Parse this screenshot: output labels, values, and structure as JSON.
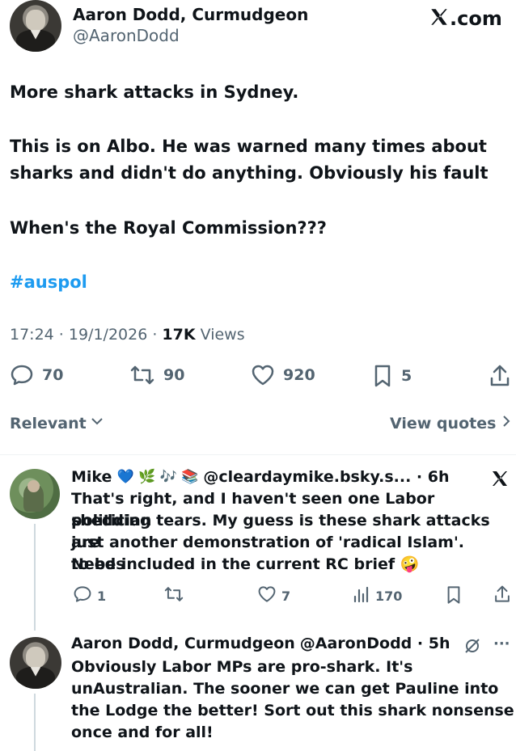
{
  "header": {
    "author_name": "Aaron Dodd, Curmudgeon",
    "author_handle": "@AaronDodd",
    "site_label": ".com"
  },
  "tweet": {
    "line1": "More shark attacks in Sydney.",
    "line2": "This is on Albo. He was warned many times about",
    "line3": "sharks and didn't do anything. Obviously his fault",
    "line4": "When's the Royal Commission???",
    "hashtag": "#auspol",
    "time": "17:24 · 19/1/2026 · ",
    "views_count": "17K",
    "views_label": " Views"
  },
  "actions": {
    "replies": "70",
    "reposts": "90",
    "likes": "920",
    "bookmarks": "5"
  },
  "filter": {
    "sort_label": "Relevant",
    "view_quotes": "View quotes"
  },
  "reply1": {
    "name": "Mike",
    "emojis": "💙 🌿 🎶 📚",
    "handle_time": "@cleardaymike.bsky.s... · 6h",
    "text1": "That's right, and I haven't seen one Labor politician",
    "text2": "shedding tears. My guess is these shark attacks are",
    "text3": "just another demonstration of 'radical Islam'. Needs",
    "text4": "to be included in the current RC brief 🤪",
    "replies": "1",
    "likes": "7",
    "views": "170"
  },
  "reply2": {
    "name": "Aaron Dodd, Curmudgeon",
    "handle_time": "@AaronDodd · 5h",
    "text1": "Obviously Labor MPs are pro-shark. It's",
    "text2": "unAustralian. The sooner we can get Pauline into",
    "text3": "the Lodge the better! Sort out this shark nonsense",
    "text4": "once and for all!"
  }
}
